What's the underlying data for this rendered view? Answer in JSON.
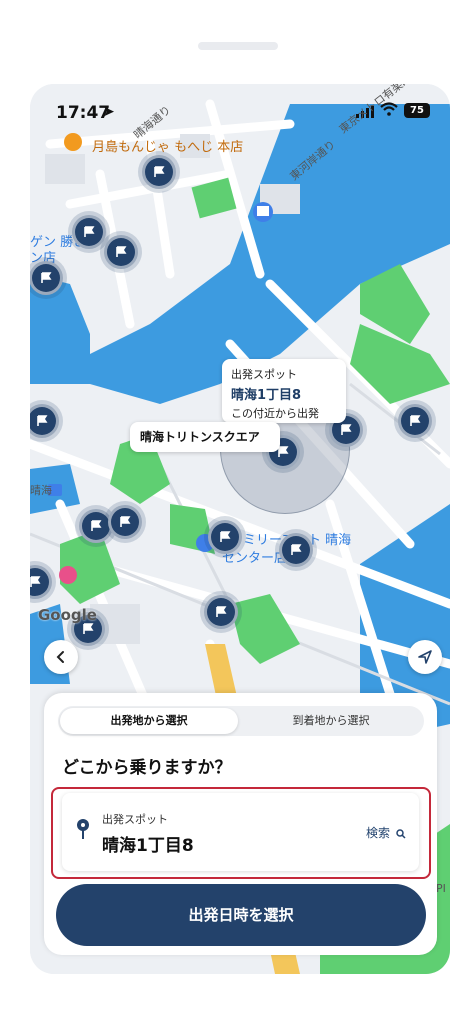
{
  "status_bar": {
    "time": "17:47",
    "battery": "75"
  },
  "map": {
    "poi_restaurant": "月島もんじゃ もへじ 本店",
    "poi_left_top": "ゲン 勝どき",
    "poi_left_top2": "ン店",
    "poi_left_mid": "晴海",
    "poi_left_low": "海",
    "poi_convenience": "ァミリーマート 晴海",
    "poi_convenience2": "センター店",
    "road_1": "東京メトロ有楽町線",
    "road_2": "東河岸通り",
    "road_3": "晴海通り",
    "google": "Google",
    "right_edge": "PI",
    "spot_bubble": {
      "caption": "出発スポット",
      "name": "晴海1丁目8",
      "note": "この付近から出発"
    },
    "triton_label": "晴海トリトンスクエア"
  },
  "sheet": {
    "tabs": {
      "from_departure": "出発地から選択",
      "from_arrival": "到着地から選択"
    },
    "question": "どこから乗りますか？",
    "field": {
      "caption": "出発スポット",
      "value": "晴海1丁目8",
      "search": "検索"
    },
    "primary_button": "出発日時を選択"
  },
  "colors": {
    "primary": "#23426b",
    "highlight_border": "#c4283a",
    "water": "#3d9be0",
    "park": "#5fcf72"
  }
}
